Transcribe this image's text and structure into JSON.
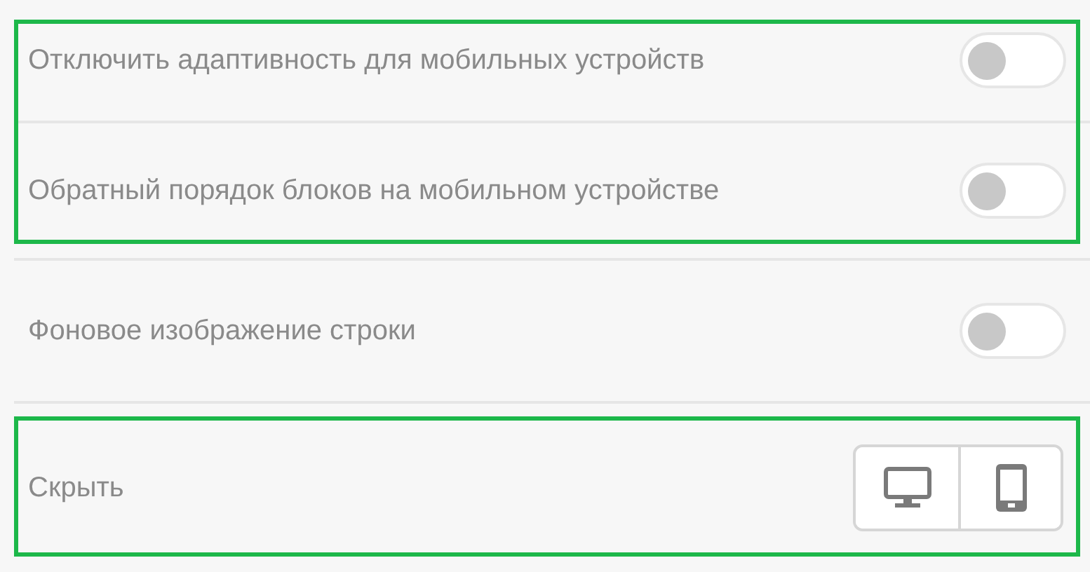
{
  "groups": [
    {
      "highlighted": true,
      "rows": [
        {
          "kind": "toggle",
          "label": "Отключить адаптивность для мобильных устройств",
          "on": false
        },
        {
          "kind": "toggle",
          "label": "Обратный порядок блоков на мобильном устройстве",
          "on": false
        }
      ]
    },
    {
      "highlighted": false,
      "rows": [
        {
          "kind": "toggle",
          "label": "Фоновое изображение строки",
          "on": false
        }
      ]
    },
    {
      "highlighted": true,
      "rows": [
        {
          "kind": "devices",
          "label": "Скрыть",
          "options": [
            {
              "kind": "desktop",
              "selected": false
            },
            {
              "kind": "mobile",
              "selected": false
            }
          ]
        }
      ]
    }
  ]
}
